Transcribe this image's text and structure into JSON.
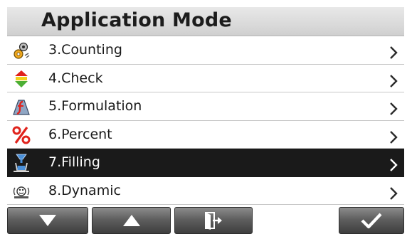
{
  "header": {
    "title": "Application Mode"
  },
  "menu": {
    "items": [
      {
        "label": "3.Counting",
        "icon": "counting-icon"
      },
      {
        "label": "4.Check",
        "icon": "check-weighing-icon"
      },
      {
        "label": "5.Formulation",
        "icon": "formulation-icon"
      },
      {
        "label": "6.Percent",
        "icon": "percent-icon"
      },
      {
        "label": "7.Filling",
        "icon": "filling-icon",
        "selected": true
      },
      {
        "label": "8.Dynamic",
        "icon": "dynamic-icon"
      }
    ]
  },
  "softkeys": [
    {
      "icon": "arrow-down-icon"
    },
    {
      "icon": "arrow-up-icon"
    },
    {
      "icon": "exit-icon"
    },
    {
      "icon": "checkmark-icon"
    }
  ],
  "colors": {
    "selected_row": "#1a1a1a",
    "percent_icon": "#e0231c",
    "key_face": "#5f5f5f"
  }
}
